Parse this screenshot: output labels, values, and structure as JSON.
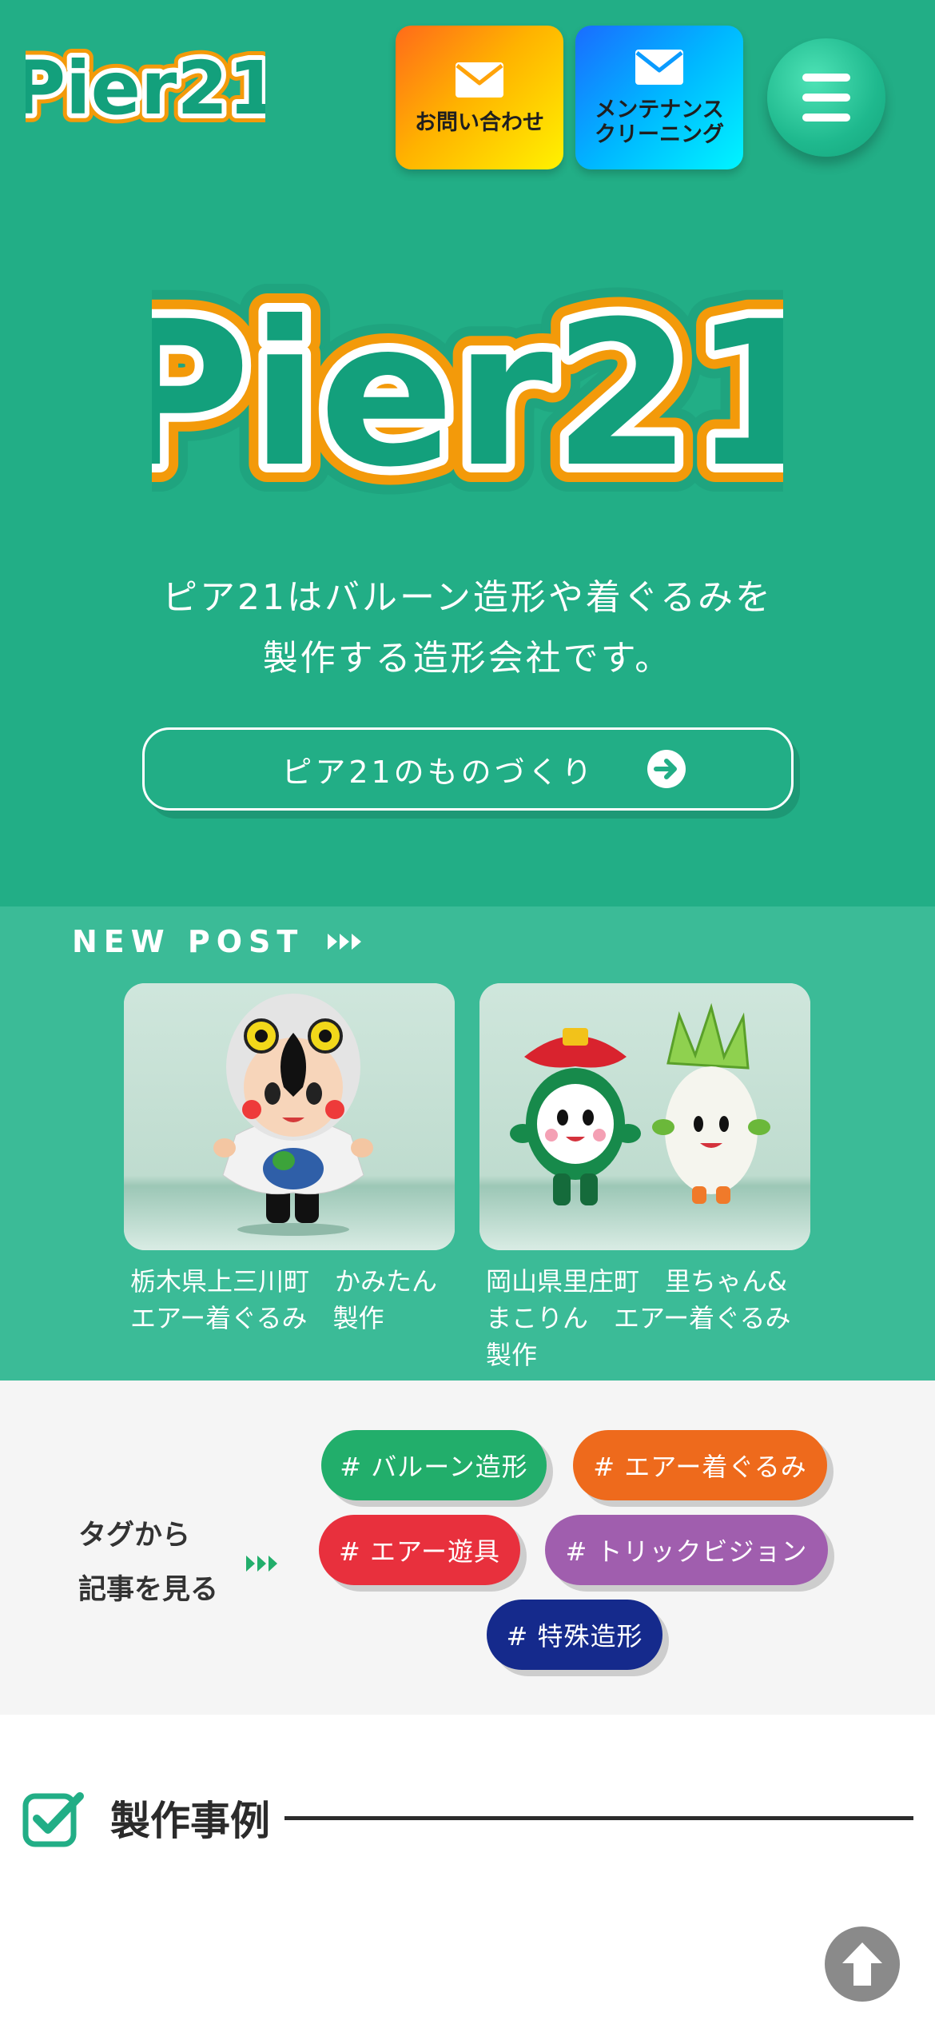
{
  "header": {
    "logo_text": "Pier21",
    "contact_label": "お問い合わせ",
    "maintenance_label": "メンテナンス\nクリーニング"
  },
  "hero": {
    "logo_text": "Pier21",
    "tagline": "ピア21はバルーン造形や着ぐるみを\n製作する造形会社です。",
    "cta_label": "ピア21のものづくり"
  },
  "new_post": {
    "title": "NEW POST",
    "posts": [
      {
        "caption": "栃木県上三川町　かみたん\nエアー着ぐるみ　製作"
      },
      {
        "caption": "岡山県里庄町　里ちゃん&\nまこりん　エアー着ぐるみ\n製作"
      }
    ]
  },
  "tags": {
    "heading": "タグから\n記事を見る",
    "items": [
      {
        "label": "# バルーン造形",
        "color": "#22ae6b"
      },
      {
        "label": "# エアー着ぐるみ",
        "color": "#ee6a1c"
      },
      {
        "label": "# エアー遊具",
        "color": "#e8303d"
      },
      {
        "label": "# トリックビジョン",
        "color": "#a05eae"
      },
      {
        "label": "# 特殊造形",
        "color": "#152a8c"
      }
    ]
  },
  "works": {
    "title": "製作事例"
  },
  "colors": {
    "brand_green": "#22ae86",
    "newpost_green": "#3bbb97",
    "logo_orange": "#f39a0a"
  }
}
